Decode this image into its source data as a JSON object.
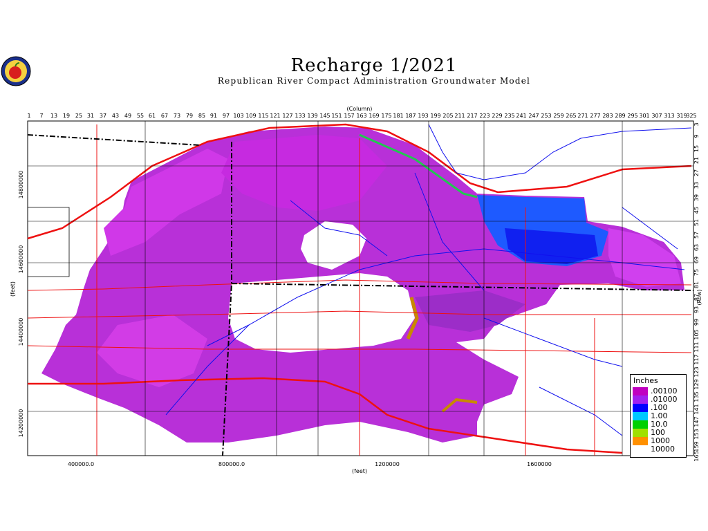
{
  "title": "Recharge  1/2021",
  "subtitle": "Republican River Compact Administration Groundwater Model",
  "axes": {
    "column_label": "(Column)",
    "row_label": "(Row)",
    "x_unit_label": "(feet)",
    "y_unit_label": "(feet)",
    "column_ticks": [
      "1",
      "7",
      "13",
      "19",
      "25",
      "31",
      "37",
      "43",
      "49",
      "55",
      "61",
      "67",
      "73",
      "79",
      "85",
      "91",
      "97",
      "103",
      "109",
      "115",
      "121",
      "127",
      "133",
      "139",
      "145",
      "151",
      "157",
      "163",
      "169",
      "175",
      "181",
      "187",
      "193",
      "199",
      "205",
      "211",
      "217",
      "223",
      "229",
      "235",
      "241",
      "247",
      "253",
      "259",
      "265",
      "271",
      "277",
      "283",
      "289",
      "295",
      "301",
      "307",
      "313",
      "319",
      "325"
    ],
    "row_ticks": [
      "3",
      "9",
      "15",
      "21",
      "27",
      "33",
      "39",
      "45",
      "51",
      "57",
      "63",
      "69",
      "75",
      "81",
      "87",
      "93",
      "99",
      "105",
      "111",
      "117",
      "123",
      "129",
      "135",
      "141",
      "147",
      "153",
      "159",
      "165"
    ],
    "x_ticks": [
      "400000.0",
      "800000.0",
      "1200000",
      "1600000"
    ],
    "y_ticks": [
      "14800000",
      "14600000",
      "14400000",
      "14200000"
    ]
  },
  "legend": {
    "title": "Inches",
    "items": [
      {
        "label": ".00100",
        "color": "#c000c0"
      },
      {
        "label": ".01000",
        "color": "#a020f0"
      },
      {
        "label": ".100",
        "color": "#0000ff"
      },
      {
        "label": "1.00",
        "color": "#00c8ff"
      },
      {
        "label": "10.0",
        "color": "#00d000"
      },
      {
        "label": "100",
        "color": "#a0e000"
      },
      {
        "label": "1000",
        "color": "#ff9000"
      },
      {
        "label": "10000",
        "color": "#ffffff"
      }
    ]
  },
  "colors": {
    "recharge_magenta": "#cc22dd",
    "recharge_purple": "#9a2bc8",
    "recharge_blue": "#1e5aff",
    "recharge_deep_blue": "#1020f0",
    "highway_red": "#ee1111",
    "river_blue": "#1010ee"
  }
}
